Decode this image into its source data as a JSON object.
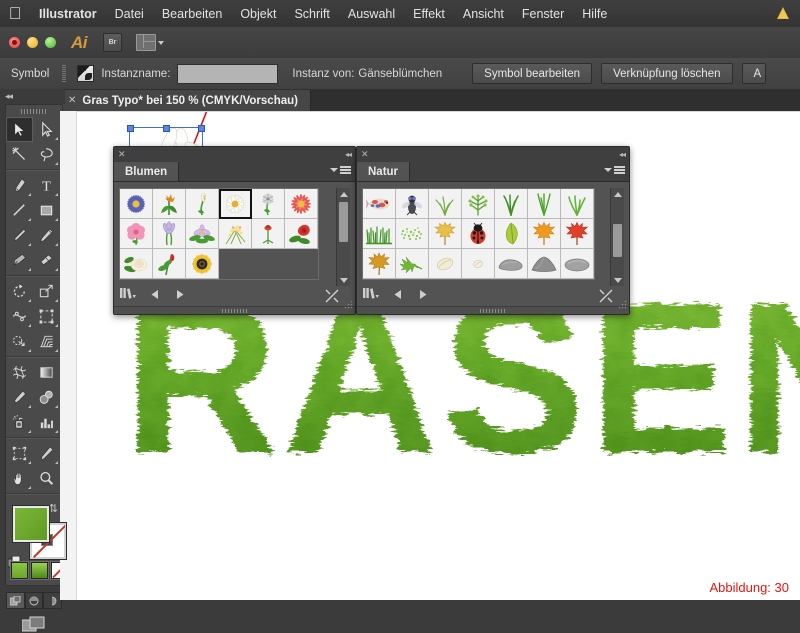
{
  "menubar": {
    "apple_icon": "apple-logo-icon",
    "app_name": "Illustrator",
    "items": [
      "Datei",
      "Bearbeiten",
      "Objekt",
      "Schrift",
      "Auswahl",
      "Effekt",
      "Ansicht",
      "Fenster",
      "Hilfe"
    ],
    "alert_icon": "alert-triangle-icon"
  },
  "appbar": {
    "ai_logo": "Ai",
    "bridge_label": "Br",
    "arrange_icon": "arrange-documents-icon",
    "close_button": "close-window-button",
    "minimize_button": "minimize-window-button",
    "zoom_button": "zoom-window-button"
  },
  "controlbar": {
    "section_label": "Symbol",
    "symbol_icon": "symbol-thumbnail-icon",
    "instance_name_label": "Instanzname:",
    "instance_name_value": "",
    "instance_of_label": "Instanz von:",
    "instance_of_value": "Gänseblümchen",
    "edit_symbol_button": "Symbol bearbeiten",
    "break_link_button": "Verknüpfung löschen",
    "cut_off_button": "A"
  },
  "document": {
    "tab_title": "Gras Typo* bei 150 % (CMYK/Vorschau)",
    "close_icon": "close-tab-icon",
    "caption": "Abbildung: 30",
    "caption_color": "#e8130f",
    "artwork_text": "RASEN"
  },
  "toolbar": {
    "tools": [
      {
        "name": "selection-tool",
        "active": true
      },
      {
        "name": "direct-selection-tool",
        "active": false
      },
      {
        "name": "magic-wand-tool",
        "active": false
      },
      {
        "name": "lasso-tool",
        "active": false
      },
      {
        "name": "pen-tool",
        "active": false
      },
      {
        "name": "type-tool",
        "active": false
      },
      {
        "name": "line-segment-tool",
        "active": false
      },
      {
        "name": "rectangle-tool",
        "active": false
      },
      {
        "name": "paintbrush-tool",
        "active": false
      },
      {
        "name": "pencil-tool",
        "active": false
      },
      {
        "name": "blob-brush-tool",
        "active": false
      },
      {
        "name": "eraser-tool",
        "active": false
      },
      {
        "name": "rotate-tool",
        "active": false
      },
      {
        "name": "scale-tool",
        "active": false
      },
      {
        "name": "width-tool",
        "active": false
      },
      {
        "name": "free-transform-tool",
        "active": false
      },
      {
        "name": "shape-builder-tool",
        "active": false
      },
      {
        "name": "perspective-grid-tool",
        "active": false
      },
      {
        "name": "mesh-tool",
        "active": false
      },
      {
        "name": "gradient-tool",
        "active": false
      },
      {
        "name": "eyedropper-tool",
        "active": false
      },
      {
        "name": "blend-tool",
        "active": false
      },
      {
        "name": "symbol-sprayer-tool",
        "active": false
      },
      {
        "name": "column-graph-tool",
        "active": false
      },
      {
        "name": "artboard-tool",
        "active": false
      },
      {
        "name": "slice-tool",
        "active": false
      },
      {
        "name": "hand-tool",
        "active": false
      },
      {
        "name": "zoom-tool",
        "active": false
      }
    ],
    "fill_color": "#6aa828",
    "stroke_color": "#ffffff",
    "stroke_none": true,
    "swatches": [
      {
        "name": "color-swatch",
        "color": "#7cba35"
      },
      {
        "name": "gradient-swatch",
        "color": "#6aa828"
      },
      {
        "name": "none-swatch",
        "color": "#ffffff"
      }
    ],
    "draw_modes": [
      "draw-normal",
      "draw-behind",
      "draw-inside"
    ],
    "screen_mode": "change-screen-mode-icon"
  },
  "panels": [
    {
      "id": "blumen",
      "title": "Blumen",
      "close_icon": "close-panel-icon",
      "collapse_icon": "collapse-panel-icon",
      "menu_icon": "panel-menu-icon",
      "columns": 6,
      "rows": 3,
      "selected_index": 3,
      "symbols": [
        {
          "name": "aster-flower-symbol"
        },
        {
          "name": "bird-of-paradise-symbol"
        },
        {
          "name": "calla-lily-symbol"
        },
        {
          "name": "daisy-symbol"
        },
        {
          "name": "dandelion-symbol"
        },
        {
          "name": "gerbera-symbol"
        },
        {
          "name": "hibiscus-symbol"
        },
        {
          "name": "iris-symbol"
        },
        {
          "name": "orchid-symbol"
        },
        {
          "name": "wildflower-symbol"
        },
        {
          "name": "poppy-bud-symbol"
        },
        {
          "name": "red-rose-symbol"
        },
        {
          "name": "white-rose-symbol"
        },
        {
          "name": "rose-bud-symbol"
        },
        {
          "name": "sunflower-symbol"
        }
      ],
      "footer": {
        "library_icon": "symbol-libraries-menu-icon",
        "prev_icon": "previous-library-icon",
        "next_icon": "next-library-icon",
        "break_link_icon": "break-link-icon",
        "resize_icon": "resize-grip-icon"
      }
    },
    {
      "id": "natur",
      "title": "Natur",
      "close_icon": "close-panel-icon",
      "collapse_icon": "collapse-panel-icon",
      "menu_icon": "panel-menu-icon",
      "columns": 7,
      "rows": 3,
      "selected_index": -1,
      "symbols": [
        {
          "name": "koi-fish-symbol"
        },
        {
          "name": "fly-symbol"
        },
        {
          "name": "reed-grass-symbol"
        },
        {
          "name": "fern-bush-symbol"
        },
        {
          "name": "grass-tuft-symbol"
        },
        {
          "name": "grass-blades-symbol"
        },
        {
          "name": "grass-clump-symbol"
        },
        {
          "name": "green-grass-row-symbol"
        },
        {
          "name": "moss-speckle-symbol"
        },
        {
          "name": "yellow-maple-leaf-symbol"
        },
        {
          "name": "ladybug-symbol"
        },
        {
          "name": "green-leaf-symbol"
        },
        {
          "name": "orange-maple-leaf-symbol"
        },
        {
          "name": "red-maple-leaf-symbol"
        },
        {
          "name": "gold-maple-leaf-symbol"
        },
        {
          "name": "oak-leaf-symbol"
        },
        {
          "name": "seed-pod-symbol"
        },
        {
          "name": "small-seed-symbol"
        },
        {
          "name": "flat-stone-symbol"
        },
        {
          "name": "pointed-stone-symbol"
        },
        {
          "name": "round-stone-symbol"
        }
      ],
      "footer": {
        "library_icon": "symbol-libraries-menu-icon",
        "prev_icon": "previous-library-icon",
        "next_icon": "next-library-icon",
        "break_link_icon": "break-link-icon",
        "resize_icon": "resize-grip-icon"
      },
      "scrollbar": {
        "name": "vertical-scrollbar",
        "thumb_position": 0.38
      }
    }
  ],
  "canvas_overlay": {
    "selection_name": "symbol-instance-selection",
    "pointer_arrow_name": "annotation-arrow",
    "pointer_arrow_color": "#d61414",
    "drag_arrow_name": "drag-indicator-arrow",
    "crosshair_name": "move-crosshair-icon"
  }
}
